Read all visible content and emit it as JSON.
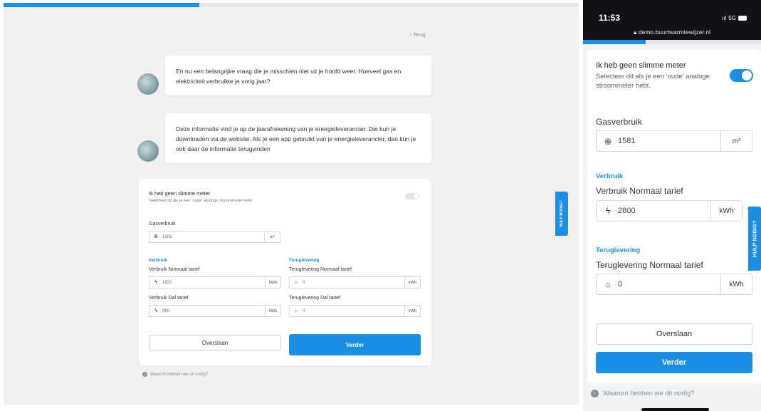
{
  "desktop": {
    "progress_pct": 34,
    "back_link": "↑ Terug",
    "bubble1": "En nu een belangrijke vraag die je misschien niet uit je hoofd weet. Hoeveel gas en elektriciteit verbruikte je vorig jaar?",
    "bubble2": "Deze informatie vind je op de jaarafrekening van je energieleverancier. Die kun je downloaden via de website. Als je een app gebruikt van je energieleverancier, dan kun je ook daar de informatie terugvinden",
    "toggle_title": "Ik heb geen slimme meter",
    "toggle_sub": "Selecteer dit als je een 'oude' analoge stroommeter hebt.",
    "toggle_on": false,
    "gas_label": "Gasverbruik",
    "gas_value": "1508",
    "gas_unit": "m³",
    "verbruik_header": "Verbruik",
    "normaal_label": "Verbruik Normaal tarief",
    "normaal_value": "1820",
    "dal_label": "Verbruik Dal tarief",
    "dal_value": "980",
    "kwh_unit": "kWh",
    "teruglevering_header": "Teruglevering",
    "terug_normaal_label": "Teruglevering Normaal tarief",
    "terug_normaal_value": "0",
    "terug_dal_label": "Teruglevering Dal tarief",
    "terug_dal_value": "0",
    "skip_button": "Overslaan",
    "next_button": "Verder",
    "why_link": "Waarom hebben we dit nodig?",
    "help_tab": "HULP NODIG?"
  },
  "mobile": {
    "time": "11:53",
    "signal": "5G",
    "url": "demo.buurtwarmtewijzer.nl",
    "toggle_title": "Ik heb geen slimme meter",
    "toggle_sub": "Selecteer dit als je een 'oude' analoge stroommeter hebt.",
    "toggle_on": true,
    "gas_label": "Gasverbruik",
    "gas_value": "1581",
    "gas_unit": "m³",
    "verbruik_header": "Verbruik",
    "normaal_label": "Verbruik Normaal tarief",
    "normaal_value": "2800",
    "kwh_unit": "kWh",
    "teruglevering_header": "Teruglevering",
    "terug_normaal_label": "Teruglevering Normaal tarief",
    "terug_normaal_value": "0",
    "skip_button": "Overslaan",
    "next_button": "Verder",
    "why_link": "Waarom hebben we dit nodig?",
    "help_tab": "HULP NODIG?"
  },
  "icons": {
    "gas": "gas-flame-icon",
    "bolt": "bolt-icon",
    "sun": "sun-icon",
    "info": "info-icon"
  },
  "colors": {
    "accent": "#1a8fe6"
  }
}
